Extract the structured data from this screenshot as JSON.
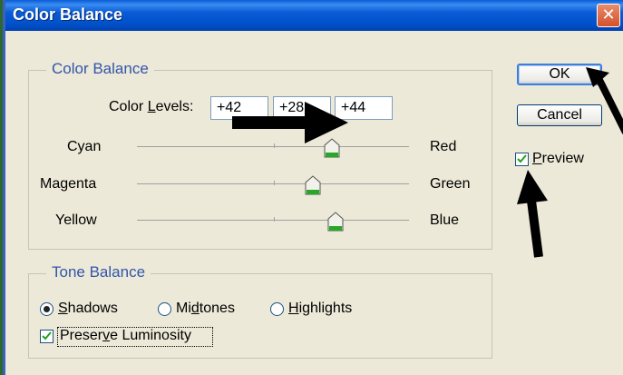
{
  "window": {
    "title": "Color Balance",
    "close_glyph": "✕"
  },
  "color_balance": {
    "group_label": "Color Balance",
    "levels_label_pre": "Color ",
    "levels_label_accel": "L",
    "levels_label_post": "evels:",
    "levels": [
      "+42",
      "+28",
      "+44"
    ],
    "sliders": [
      {
        "left": "Cyan",
        "right": "Red",
        "value": 42
      },
      {
        "left": "Magenta",
        "right": "Green",
        "value": 28
      },
      {
        "left": "Yellow",
        "right": "Blue",
        "value": 44
      }
    ]
  },
  "tone_balance": {
    "group_label": "Tone Balance",
    "options": [
      {
        "pre": "",
        "accel": "S",
        "post": "hadows",
        "selected": true
      },
      {
        "pre": "Mi",
        "accel": "d",
        "post": "tones",
        "selected": false
      },
      {
        "pre": "",
        "accel": "H",
        "post": "ighlights",
        "selected": false
      }
    ],
    "preserve_pre": "Preser",
    "preserve_accel": "v",
    "preserve_post": "e Luminosity",
    "preserve_checked": true
  },
  "buttons": {
    "ok": "OK",
    "cancel": "Cancel",
    "preview_accel": "P",
    "preview_post": "review",
    "preview_checked": true
  },
  "colors": {
    "titlebar": "#0a5bd6",
    "group_label": "#3355aa",
    "check_mark": "#21a121",
    "thumb_green": "#28a828"
  }
}
